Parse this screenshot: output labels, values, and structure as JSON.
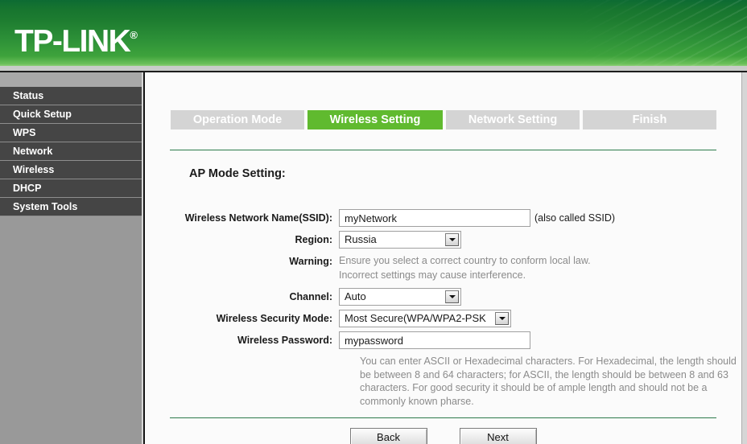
{
  "header": {
    "brand": "TP-LINK",
    "registered_mark": "®"
  },
  "sidebar": {
    "items": [
      {
        "label": "Status"
      },
      {
        "label": "Quick Setup"
      },
      {
        "label": "WPS"
      },
      {
        "label": "Network"
      },
      {
        "label": "Wireless"
      },
      {
        "label": "DHCP"
      },
      {
        "label": "System Tools"
      }
    ]
  },
  "wizard": {
    "tabs": [
      {
        "label": "Operation Mode",
        "active": false
      },
      {
        "label": "Wireless Setting",
        "active": true
      },
      {
        "label": "Network Setting",
        "active": false
      },
      {
        "label": "Finish",
        "active": false
      }
    ],
    "active_tab": "Wireless Setting"
  },
  "main": {
    "section_title": "AP Mode Setting:",
    "fields": {
      "ssid": {
        "label": "Wireless Network Name(SSID):",
        "value": "myNetwork",
        "note": "(also called SSID)"
      },
      "region": {
        "label": "Region:",
        "value": "Russia"
      },
      "warning": {
        "label": "Warning:",
        "line1": "Ensure you select a correct country to conform local law.",
        "line2": "Incorrect settings may cause interference."
      },
      "channel": {
        "label": "Channel:",
        "value": "Auto"
      },
      "security_mode": {
        "label": "Wireless Security Mode:",
        "value": "Most Secure(WPA/WPA2-PSK"
      },
      "password": {
        "label": "Wireless Password:",
        "value": "mypassword",
        "help": "You can enter ASCII or Hexadecimal characters. For Hexadecimal, the length should be between 8 and 64 characters; for ASCII, the length should be between 8 and 63 characters. For good security it should be of ample length and should not be a commonly known pharse."
      }
    },
    "buttons": {
      "back": "Back",
      "next": "Next"
    }
  },
  "colors": {
    "banner_green_dark": "#0d6b33",
    "banner_green_light": "#8ecf78",
    "tab_active": "#60ba2f",
    "tab_inactive": "#d4d4d4",
    "sidebar_item": "#454545",
    "sidebar_bg": "#999999",
    "rule_green": "#2c7a4b",
    "hint_gray": "#8b8b8b"
  }
}
